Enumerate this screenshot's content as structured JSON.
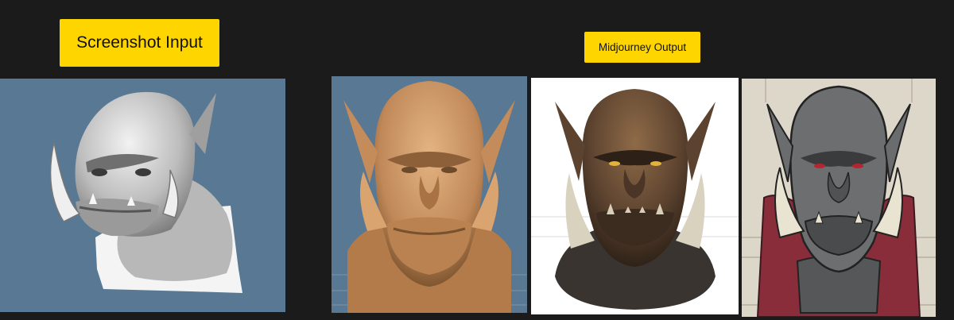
{
  "labels": {
    "input": "Screenshot Input",
    "output": "Midjourney Output"
  },
  "colors": {
    "background": "#1b1b1b",
    "label_bg": "#ffd500",
    "label_text": "#111111",
    "viewport_blue": "#587893",
    "clay_tan": "#c8905c",
    "skin_brown": "#6a4e34",
    "gray_skin": "#6c6e70",
    "cloak_red": "#8a2d3a",
    "paper_beige": "#ddd7c9"
  },
  "images": [
    {
      "id": "input",
      "subject": "orc-bust-gray-sculpt",
      "background": "viewport-blue"
    },
    {
      "id": "output-1",
      "subject": "orc-bust-tan-clay",
      "background": "viewport-blue-grid"
    },
    {
      "id": "output-2",
      "subject": "orc-bust-realistic-brown",
      "background": "white"
    },
    {
      "id": "output-3",
      "subject": "orc-bust-illustrated-gray",
      "background": "beige-paper"
    }
  ]
}
